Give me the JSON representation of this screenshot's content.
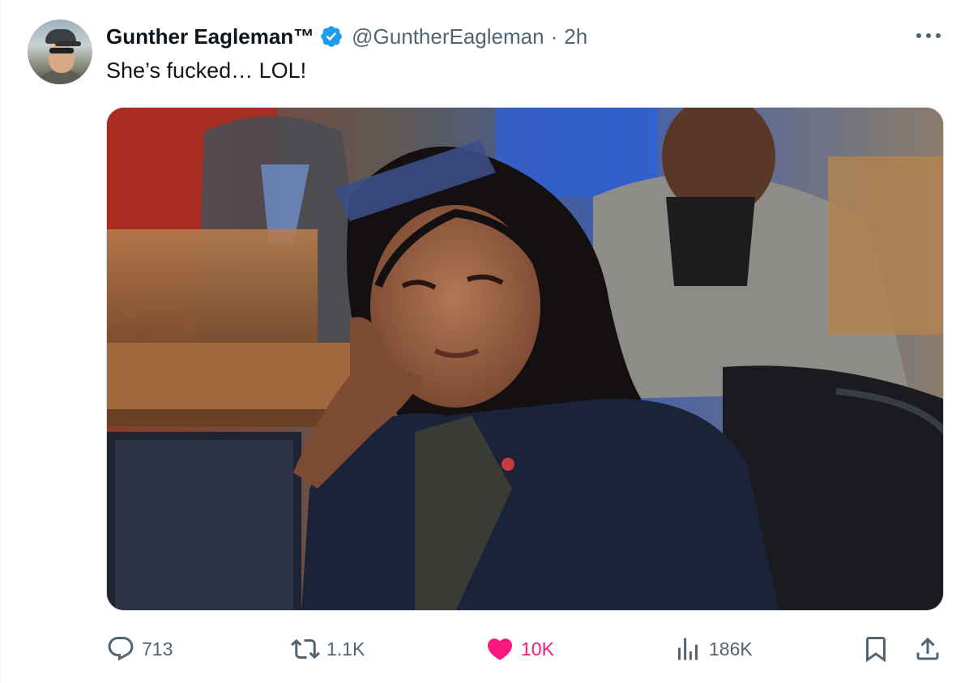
{
  "author": {
    "display_name": "Gunther Eagleman™",
    "handle": "@GuntherEagleman",
    "separator": "·",
    "time": "2h",
    "verified": true,
    "verified_color": "#1d9bf0"
  },
  "tweet": {
    "text": "She’s fucked… LOL!"
  },
  "icons": {
    "more": "more-horizontal-icon",
    "reply": "reply-bubble-icon",
    "retweet": "retweet-icon",
    "like": "heart-filled-icon",
    "views": "bar-chart-icon",
    "bookmark": "bookmark-icon",
    "share": "share-upload-icon"
  },
  "metrics": {
    "replies": "713",
    "retweets": "1.1K",
    "likes": "10K",
    "views": "186K"
  },
  "colors": {
    "secondary_text": "#536471",
    "like_pink": "#f91880",
    "primary_text": "#0f1419"
  }
}
